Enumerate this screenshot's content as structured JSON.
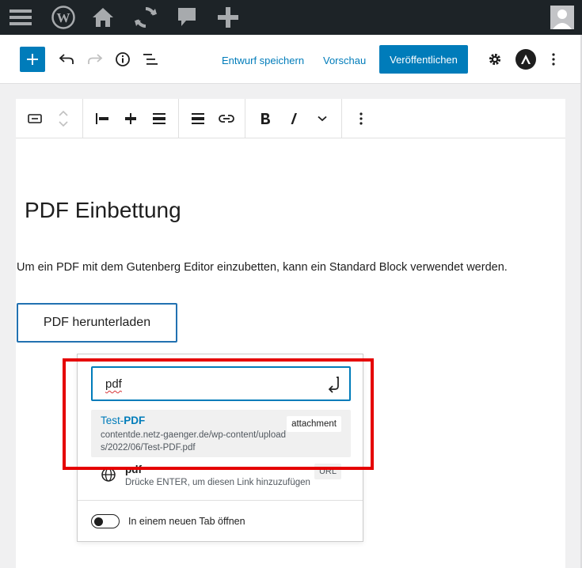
{
  "admin_bar": {
    "icons": [
      "menu-icon",
      "wordpress-logo-icon",
      "home-icon",
      "updates-icon",
      "comments-icon",
      "new-content-icon"
    ]
  },
  "header": {
    "save_draft": "Entwurf speichern",
    "preview": "Vorschau",
    "publish": "Veröffentlichen"
  },
  "content": {
    "heading": "PDF Einbettung",
    "paragraph": "Um ein PDF mit dem Gutenberg Editor einzubetten, kann ein Standard Block verwendet werden.",
    "button_label": "PDF herunterladen"
  },
  "link_popover": {
    "input_value": "pdf",
    "suggestion": {
      "title_prefix": "Test-",
      "title_match": "PDF",
      "url": "contentde.netz-gaenger.de/wp-content/uploads/2022/06/Test-PDF.pdf",
      "type": "attachment"
    },
    "url_suggestion": {
      "title": "pdf",
      "hint": "Drücke ENTER, um diesen Link hinzuzufügen",
      "type": "URL"
    },
    "new_tab_label": "In einem neuen Tab öffnen",
    "new_tab_enabled": false
  },
  "colors": {
    "accent": "#007cba",
    "admin_bar": "#1d2327",
    "highlight": "#e50000"
  }
}
